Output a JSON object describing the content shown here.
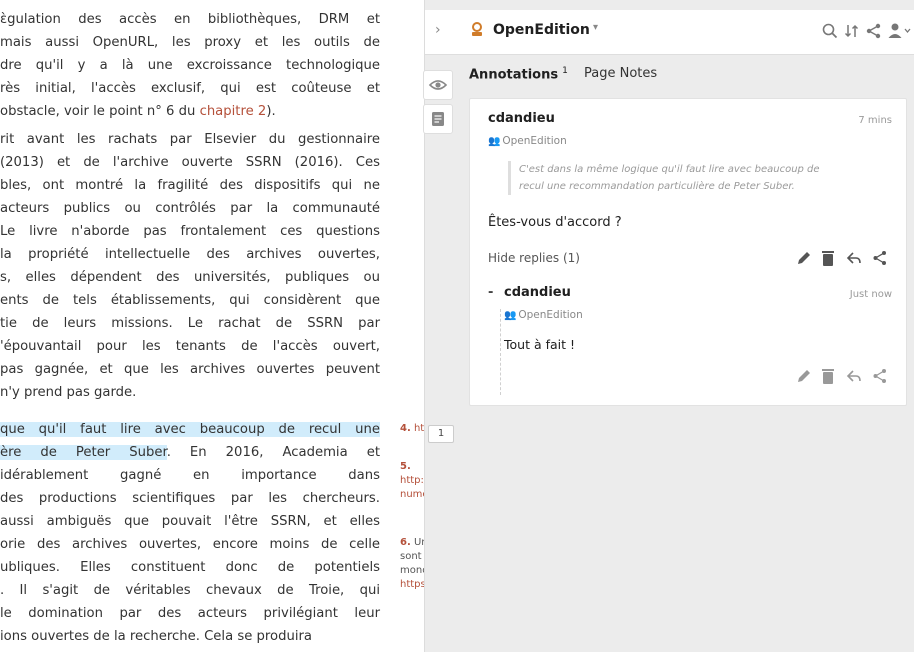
{
  "book": {
    "p1": [
      "ɛ̀gulation des accès en bibliothèques, DRM et",
      "mais aussi OpenURL, les proxy et les outils de",
      "dre qu'il y a là une excroissance technologique",
      "rès initial, l'accès exclusif, qui est coûteuse et",
      "obstacle, voir le point n° 6 du "
    ],
    "p1_link": "chapitre 2",
    "p1_tail": ").",
    "p2": [
      "rit avant les rachats par Elsevier du gestionnaire",
      "(2013) et de l'archive ouverte SSRN (2016). Ces",
      "bles, ont montré la fragilité des dispositifs qui ne",
      "acteurs publics ou contrôlés par la communauté",
      "Le livre n'aborde pas frontalement ces questions",
      "la propriété intellectuelle des archives ouvertes,",
      "s, elles dépendent des universités, publiques ou",
      "ents de tels établissements, qui considèrent que",
      "tie de leurs missions. Le rachat de SSRN par",
      "'épouvantail pour les tenants de l'accès ouvert,",
      "pas gagnée, et que les archives ouvertes peuvent",
      "n'y prend pas garde."
    ],
    "p3_hl1": "que qu'il faut lire avec beaucoup de recul une",
    "p3_hl2": "ère de Peter Suber",
    "p3_l2_tail": ". En 2016, Academia et",
    "p3": [
      "idérablement gagné en importance dans",
      "des productions scientifiques par les chercheurs.",
      "aussi ambiguës que pouvait l'être SSRN, et elles",
      "orie des archives ouvertes, encore moins de celle",
      "ubliques. Elles constituent donc de potentiels",
      ". Il s'agit de véritables chevaux de Troie, qui",
      "le domination par des acteurs privilégiant leur",
      "ions ouvertes de la recherche. Cela se produira"
    ]
  },
  "footnotes": {
    "n4_num": "4.",
    "n4_text": "http:/",
    "n5_num": "5.",
    "n5_lines": [
      "http://bit",
      "numeriqu"
    ],
    "n6_num": "6.",
    "n6_lines": [
      "Un mi",
      "sont abo",
      "monde p",
      "https://g"
    ],
    "badge_count": "1"
  },
  "panel": {
    "collapse_glyph": "›",
    "group_name": "OpenEdition",
    "group_caret": "▾",
    "tabs": {
      "annotations_label": "Annotations",
      "annotations_count": "1",
      "page_notes_label": "Page Notes"
    },
    "annotation": {
      "user": "cdandieu",
      "time": "7 mins",
      "group": "OpenEdition",
      "quote_lines": [
        "C'est dans la même logique qu'il faut lire avec beaucoup de",
        "recul une recommandation particulière de Peter Suber."
      ],
      "text": "Êtes-vous d'accord ?",
      "hide_replies": "Hide replies (1)"
    },
    "reply": {
      "collapse": "-",
      "user": "cdandieu",
      "time": "Just now",
      "group": "OpenEdition",
      "text": "Tout à fait !"
    }
  },
  "colors": {
    "accent": "#d07c2a",
    "highlight": "#d1ecfb",
    "link": "#b4503a"
  },
  "icons": [
    "search-icon",
    "sort-icon",
    "share-icon",
    "user-icon",
    "eye-icon",
    "note-icon",
    "edit-icon",
    "delete-icon",
    "reply-icon"
  ]
}
